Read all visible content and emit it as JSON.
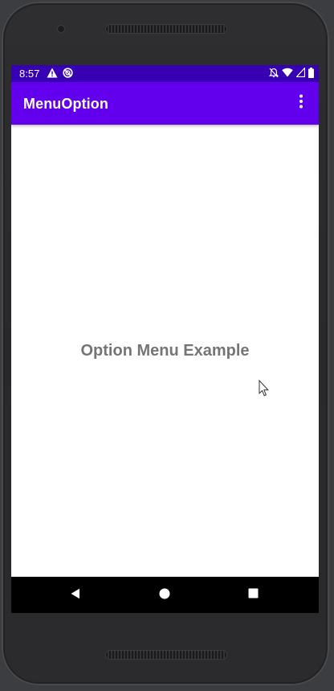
{
  "status_bar": {
    "time": "8:57",
    "left_icons": [
      "warning-icon",
      "sync-disabled-icon"
    ],
    "right_icons": [
      "notifications-off-icon",
      "wifi-icon",
      "cell-signal-icon",
      "battery-icon"
    ],
    "color": "#3700b3"
  },
  "app_bar": {
    "title": "MenuOption",
    "overflow_icon": "more-vert-icon",
    "color": "#6200ee"
  },
  "main": {
    "text": "Option Menu Example",
    "text_color": "#757575"
  },
  "nav_bar": {
    "buttons": [
      "back-icon",
      "home-icon",
      "recents-icon"
    ]
  }
}
